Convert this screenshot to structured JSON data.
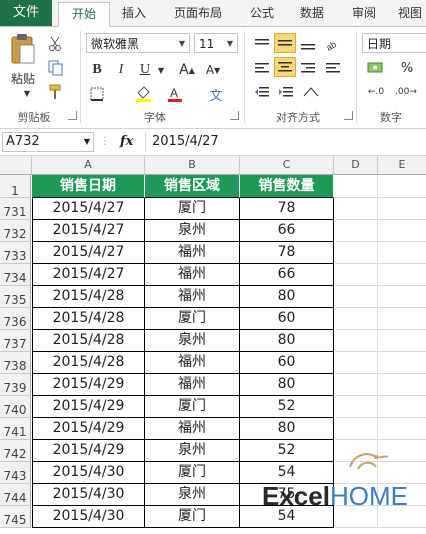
{
  "ribbon_tabs": [
    "文件",
    "开始",
    "插入",
    "页面布局",
    "公式",
    "数据",
    "审阅",
    "视图"
  ],
  "clipboard": {
    "paste_label": "粘贴",
    "group_label": "剪贴板"
  },
  "font": {
    "name": "微软雅黑",
    "size": "11",
    "group_label": "字体",
    "bold": "B",
    "italic": "I",
    "underline": "U",
    "wen_label": "文"
  },
  "alignment": {
    "group_label": "对齐方式"
  },
  "number": {
    "format": "日期",
    "group_label": "数字",
    "percent": "%"
  },
  "formula_bar": {
    "name_box": "A732",
    "fx": "fx",
    "value": "2015/4/27"
  },
  "columns": [
    "A",
    "B",
    "C",
    "D",
    "E"
  ],
  "table": {
    "header_row_number": "1",
    "headers": [
      "销售日期",
      "销售区域",
      "销售数量"
    ],
    "rows": [
      {
        "row": "731",
        "date": "2015/4/27",
        "region": "厦门",
        "qty": "78"
      },
      {
        "row": "732",
        "date": "2015/4/27",
        "region": "泉州",
        "qty": "66"
      },
      {
        "row": "733",
        "date": "2015/4/27",
        "region": "福州",
        "qty": "78"
      },
      {
        "row": "734",
        "date": "2015/4/27",
        "region": "福州",
        "qty": "66"
      },
      {
        "row": "735",
        "date": "2015/4/28",
        "region": "福州",
        "qty": "80"
      },
      {
        "row": "736",
        "date": "2015/4/28",
        "region": "厦门",
        "qty": "60"
      },
      {
        "row": "737",
        "date": "2015/4/28",
        "region": "泉州",
        "qty": "80"
      },
      {
        "row": "738",
        "date": "2015/4/28",
        "region": "福州",
        "qty": "60"
      },
      {
        "row": "739",
        "date": "2015/4/29",
        "region": "福州",
        "qty": "80"
      },
      {
        "row": "740",
        "date": "2015/4/29",
        "region": "厦门",
        "qty": "52"
      },
      {
        "row": "741",
        "date": "2015/4/29",
        "region": "福州",
        "qty": "80"
      },
      {
        "row": "742",
        "date": "2015/4/29",
        "region": "泉州",
        "qty": "52"
      },
      {
        "row": "743",
        "date": "2015/4/30",
        "region": "厦门",
        "qty": "54"
      },
      {
        "row": "744",
        "date": "2015/4/30",
        "region": "泉州",
        "qty": "75"
      },
      {
        "row": "745",
        "date": "2015/4/30",
        "region": "厦门",
        "qty": "54"
      }
    ]
  },
  "watermark": {
    "text_excel": "Excel",
    "text_home": "HOME"
  },
  "colors": {
    "excel_green": "#1e7145",
    "header_green": "#1e9a58",
    "watermark_blue": "#3a7dc9"
  }
}
